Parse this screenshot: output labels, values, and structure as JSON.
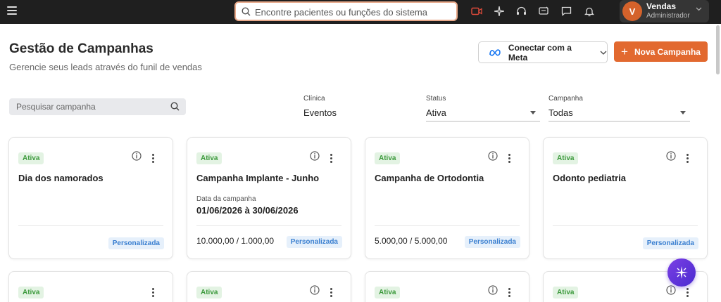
{
  "topbar": {
    "search_placeholder": "Encontre pacientes ou funções do sistema",
    "icons": [
      "video-icon",
      "sparkle-icon",
      "headset-icon",
      "announcement-icon",
      "chat-icon",
      "bell-icon"
    ],
    "user": {
      "initial": "V",
      "name": "Vendas",
      "role": "Administrador"
    },
    "accent": "#d4622b"
  },
  "header": {
    "title": "Gestão de Campanhas",
    "subtitle": "Gerencie seus leads através do funil de vendas",
    "meta_button": "Conectar com a Meta",
    "new_button": "Nova Campanha"
  },
  "filters": {
    "search_placeholder": "Pesquisar campanha",
    "clinic": {
      "label": "Clínica",
      "value": "Eventos"
    },
    "status": {
      "label": "Status",
      "value": "Ativa"
    },
    "campaign": {
      "label": "Campanha",
      "value": "Todas"
    }
  },
  "cards": [
    {
      "status": "Ativa",
      "title": "Dia dos namorados",
      "date_label": "",
      "date": "",
      "amount": "",
      "tag": "Personalizada"
    },
    {
      "status": "Ativa",
      "title": "Campanha Implante - Junho",
      "date_label": "Data da campanha",
      "date": "01/06/2026 à 30/06/2026",
      "amount": "10.000,00 / 1.000,00",
      "tag": "Personalizada"
    },
    {
      "status": "Ativa",
      "title": "Campanha de Ortodontia",
      "date_label": "",
      "date": "",
      "amount": "5.000,00 / 5.000,00",
      "tag": "Personalizada"
    },
    {
      "status": "Ativa",
      "title": "Odonto pediatria",
      "date_label": "",
      "date": "",
      "amount": "",
      "tag": "Personalizada"
    },
    {
      "status": "Ativa"
    },
    {
      "status": "Ativa"
    },
    {
      "status": "Ativa"
    },
    {
      "status": "Ativa"
    }
  ],
  "colors": {
    "primary": "#e2692f",
    "badge_green": "#3d9a3d",
    "badge_blue": "#3a7fd0",
    "fab": "#5a34d8"
  }
}
